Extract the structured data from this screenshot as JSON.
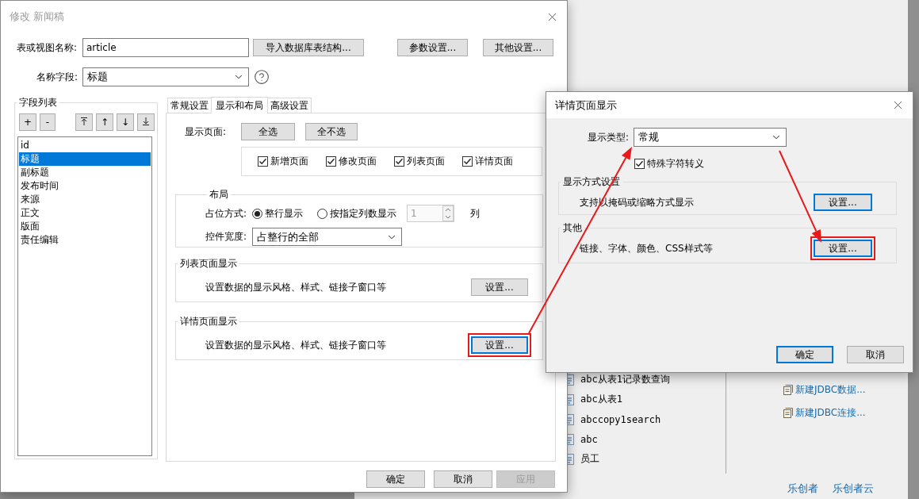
{
  "main_dialog": {
    "title": "修改 新闻稿",
    "table_label": "表或视图名称:",
    "table_value": "article",
    "top_buttons": [
      "导入数据库表结构...",
      "参数设置...",
      "其他设置..."
    ],
    "name_field_label": "名称字段:",
    "name_field_value": "标题",
    "field_list": {
      "title": "字段列表",
      "tool_buttons": [
        "+",
        "-",
        "↑",
        "↓"
      ],
      "items": [
        {
          "label": "id",
          "selected": false
        },
        {
          "label": "标题",
          "selected": true
        },
        {
          "label": "副标题",
          "selected": false
        },
        {
          "label": "发布时间",
          "selected": false
        },
        {
          "label": "来源",
          "selected": false
        },
        {
          "label": "正文",
          "selected": false
        },
        {
          "label": "版面",
          "selected": false
        },
        {
          "label": "责任编辑",
          "selected": false
        }
      ]
    },
    "tabs": [
      {
        "label": "常规设置",
        "selected": false
      },
      {
        "label": "显示和布局",
        "selected": true
      },
      {
        "label": "高级设置",
        "selected": false
      }
    ],
    "display_pages": {
      "label": "显示页面:",
      "buttons": [
        "全选",
        "全不选"
      ],
      "pages": [
        {
          "label": "新增页面",
          "checked": true
        },
        {
          "label": "修改页面",
          "checked": true
        },
        {
          "label": "列表页面",
          "checked": true
        },
        {
          "label": "详情页面",
          "checked": true
        }
      ]
    },
    "layout": {
      "title": "布局",
      "placement_label": "占位方式:",
      "placement_options": [
        {
          "label": "整行显示",
          "selected": true
        },
        {
          "label": "按指定列数显示",
          "selected": false
        }
      ],
      "columns_value": "1",
      "columns_disabled": true,
      "columns_unit": "列",
      "width_label": "控件宽度:",
      "width_value": "占整行的全部"
    },
    "sections": [
      {
        "title": "列表页面显示",
        "text": "设置数据的显示风格、样式、链接子窗口等",
        "button": "设置...",
        "focused": false,
        "highlighted": false
      },
      {
        "title": "详情页面显示",
        "text": "设置数据的显示风格、样式、链接子窗口等",
        "button": "设置...",
        "focused": true,
        "highlighted": true
      }
    ],
    "footer_buttons": [
      {
        "label": "确定",
        "disabled": false
      },
      {
        "label": "取消",
        "disabled": false
      },
      {
        "label": "应用",
        "disabled": true
      }
    ]
  },
  "detail_dialog": {
    "title": "详情页面显示",
    "type_label": "显示类型:",
    "type_value": "常规",
    "escape": {
      "label": "特殊字符转义",
      "checked": true
    },
    "sections": [
      {
        "title": "显示方式设置",
        "text": "支持以掩码或缩略方式显示",
        "button": "设置...",
        "focused": true,
        "highlighted": false
      },
      {
        "title": "其他",
        "text": "链接、字体、颜色、CSS样式等",
        "button": "设置...",
        "focused": true,
        "highlighted": true
      }
    ],
    "footer_buttons": [
      {
        "label": "确定",
        "focused": true
      },
      {
        "label": "取消",
        "focused": false
      }
    ]
  },
  "background": {
    "items": [
      "abc从表1记录数查询",
      "abc从表1",
      "abccopy1search",
      "abc",
      "员工"
    ],
    "links": [
      "新建JDBC数据...",
      "新建JDBC连接..."
    ],
    "footer_links": [
      "乐创者",
      "乐创者云"
    ]
  }
}
